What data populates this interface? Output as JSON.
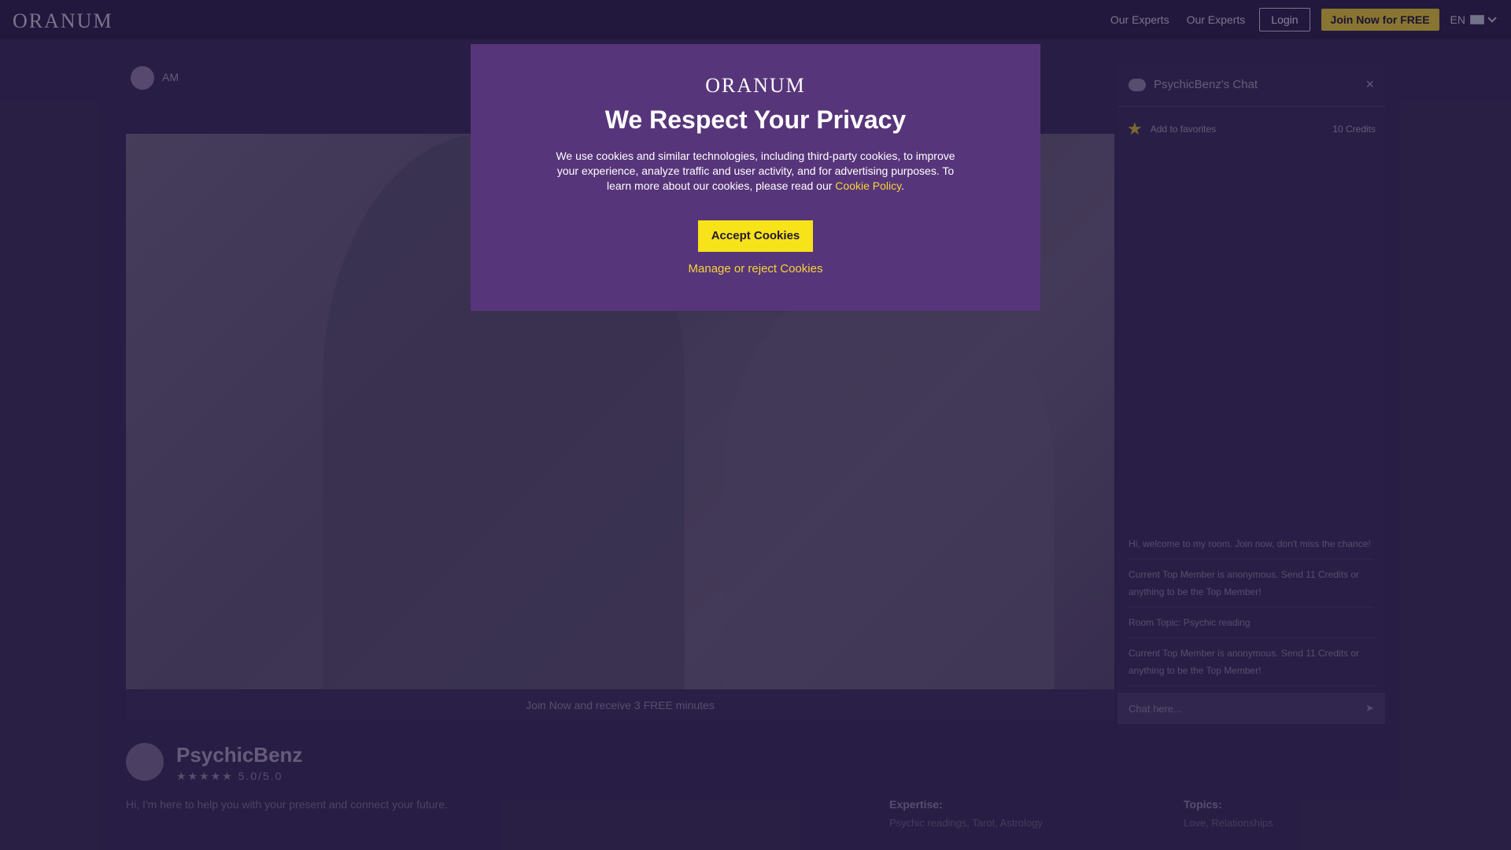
{
  "header": {
    "logo": "ORANUM",
    "links": [
      "Our Experts",
      "Our Experts"
    ],
    "login": "Login",
    "join": "Join Now for FREE",
    "lang": "EN"
  },
  "video": {
    "mini_name": "AM",
    "bar_text": "Join Now and receive 3 FREE minutes"
  },
  "chat": {
    "title": "PsychicBenz's Chat",
    "close": "×",
    "rate_label": "Add to favorites",
    "credits": "10 Credits",
    "messages": [
      "Hi, welcome to my room. Join now, don't miss the chance!",
      "Current Top Member is anonymous. Send 11 Credits or anything to be the Top Member!",
      "Room Topic: Psychic reading",
      "Current Top Member is anonymous. Send 11 Credits or anything to be the Top Member!"
    ],
    "input_placeholder": "Chat here..."
  },
  "profile": {
    "name": "PsychicBenz",
    "rating": "★★★★★ 5.0/5.0",
    "description": "Hi, I'm here to help you with your present and connect your future.",
    "expertise_label": "Expertise:",
    "expertise_value": "Psychic readings, Tarot, Astrology",
    "topics_label": "Topics:",
    "topics_value": "Love, Relationships"
  },
  "modal": {
    "logo": "ORANUM",
    "title": "We Respect Your Privacy",
    "text": "We use cookies and similar technologies, including third-party cookies, to improve your experience, analyze traffic and user activity, and for advertising purposes. To learn more about our cookies, please read our ",
    "link": "Cookie Policy",
    "text_end": ".",
    "accept": "Accept Cookies",
    "manage": "Manage or reject Cookies"
  },
  "colors": {
    "modal_bg": "#57357a",
    "accent_yellow": "#f7e319",
    "link_yellow": "#f5d43a",
    "page_bg": "#3a2d5b"
  }
}
